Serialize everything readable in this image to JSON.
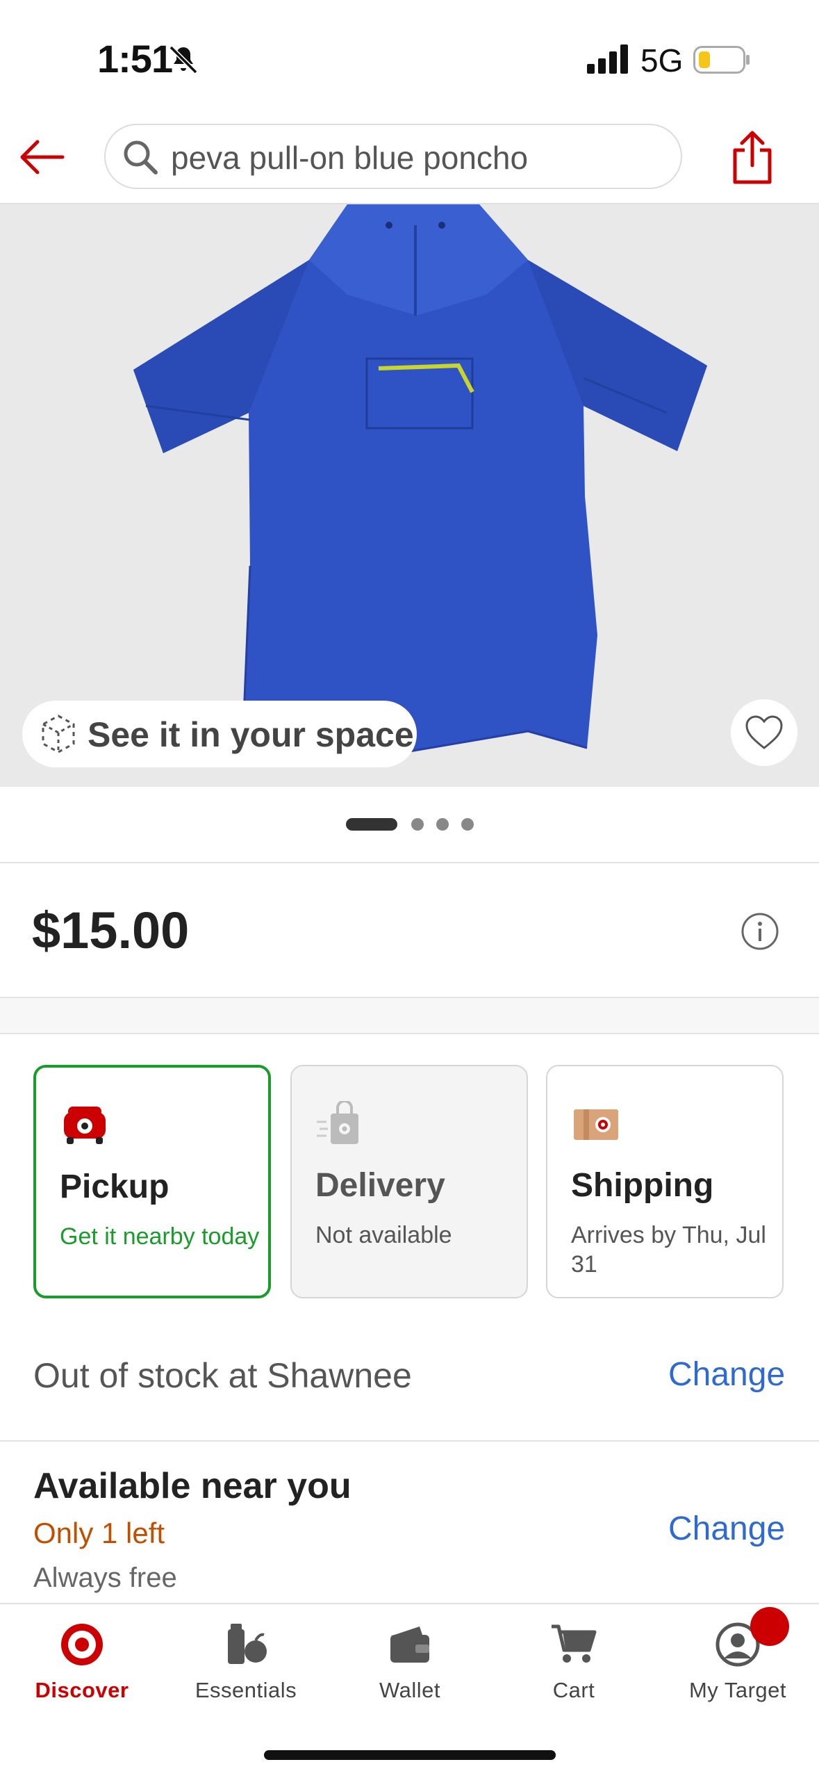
{
  "status_bar": {
    "time": "1:51",
    "network": "5G",
    "battery_color": "#f5c518"
  },
  "header": {
    "search_value": "peva pull-on blue poncho"
  },
  "hero": {
    "ar_label": "See it in your space",
    "image_count": 4,
    "active_image": 1,
    "product_color": "#2f53c4"
  },
  "price": {
    "value": "$15.00"
  },
  "fulfillment": [
    {
      "title": "Pickup",
      "subtitle": "Get it nearby today",
      "selected": true,
      "subtitle_color": "#1a9c2a",
      "icon": "pickup-car-icon"
    },
    {
      "title": "Delivery",
      "subtitle": "Not available",
      "selected": false,
      "disabled": true,
      "icon": "delivery-bag-icon"
    },
    {
      "title": "Shipping",
      "subtitle": "Arrives by Thu, Jul 31",
      "selected": false,
      "icon": "shipping-box-icon"
    }
  ],
  "store": {
    "text": "Out of stock at Shawnee",
    "change_label": "Change"
  },
  "nearby": {
    "title": "Available near you",
    "stock": "Only 1 left",
    "note": "Always free",
    "change_label": "Change"
  },
  "nav": {
    "items": [
      {
        "label": "Discover",
        "icon": "bullseye-icon",
        "active": true
      },
      {
        "label": "Essentials",
        "icon": "essentials-icon",
        "active": false
      },
      {
        "label": "Wallet",
        "icon": "wallet-icon",
        "active": false
      },
      {
        "label": "Cart",
        "icon": "cart-icon",
        "active": false
      },
      {
        "label": "My Target",
        "icon": "profile-icon",
        "active": false
      }
    ]
  },
  "colors": {
    "brand_red": "#cc0000",
    "link_blue": "#2e6ad0",
    "stock_orange": "#c05000",
    "pickup_green": "#1a9c2a"
  }
}
